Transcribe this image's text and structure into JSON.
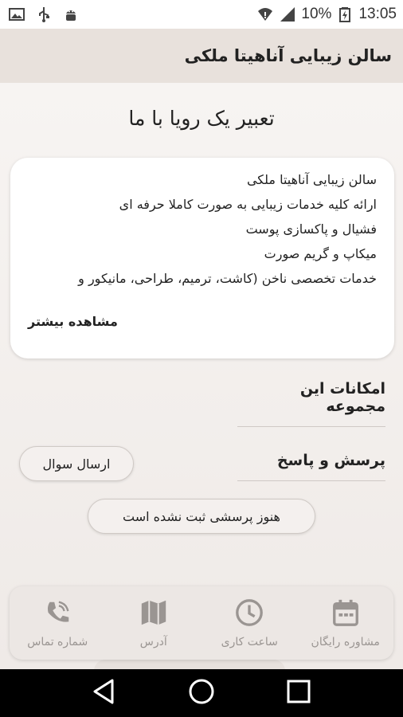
{
  "status_bar": {
    "battery_percent": "10%",
    "time": "13:05",
    "icons_left": [
      "image-icon",
      "usb-icon",
      "android-debug-icon"
    ],
    "icons_right": [
      "wifi-icon",
      "signal-icon",
      "battery-charging-icon"
    ]
  },
  "app_bar": {
    "title": "سالن زیبایی آناهیتا ملکی"
  },
  "hero": {
    "title": "تعبیر یک رویا با ما"
  },
  "about": {
    "lines": [
      "سالن زیبایی آناهیتا ملکی",
      "ارائه کلیه خدمات زیبایی به صورت کاملا حرفه ای",
      "فشیال و پاکسازی پوست",
      " میکاپ و گریم صورت",
      "خدمات تخصصی ناخن (کاشت، ترمیم، طراحی، مانیکور و"
    ],
    "more_label": "مشاهده بیشتر"
  },
  "features": {
    "heading": "امکانات این مجموعه"
  },
  "qa": {
    "heading": "پرسش و پاسخ",
    "ask_label": "ارسال سوال",
    "empty_label": "هنوز پرسشی ثبت نشده است"
  },
  "bottom_nav": {
    "items": [
      {
        "label": "مشاوره رایگان",
        "icon": "calendar-icon"
      },
      {
        "label": "ساعت کاری",
        "icon": "clock-icon"
      },
      {
        "label": "آدرس",
        "icon": "map-icon"
      },
      {
        "label": "شماره تماس",
        "icon": "phone-icon"
      }
    ]
  },
  "system_nav": {
    "buttons": [
      "back-icon",
      "home-icon",
      "recents-icon"
    ]
  },
  "colors": {
    "app_bar_bg": "#e8e1dc",
    "page_bg": "#f0ecea",
    "nav_icon": "#9a9592"
  }
}
